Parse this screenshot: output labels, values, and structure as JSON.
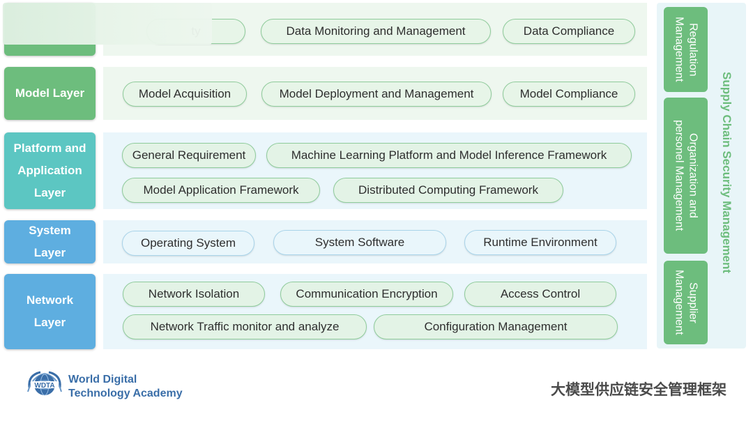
{
  "layers": [
    {
      "name": "",
      "pills": [
        {
          "label": "ty"
        },
        {
          "label": "Data Monitoring and Management"
        },
        {
          "label": "Data Compliance"
        }
      ]
    },
    {
      "name": "Model Layer",
      "pills": [
        {
          "label": "Model Acquisition"
        },
        {
          "label": "Model Deployment  and Management"
        },
        {
          "label": "Model Compliance"
        }
      ]
    },
    {
      "name": "Platform and\nApplication\nLayer",
      "pills": [
        {
          "label": "General Requirement"
        },
        {
          "label": "Machine Learning Platform and Model Inference Framework"
        },
        {
          "label": "Model Application Framework"
        },
        {
          "label": "Distributed Computing Framework"
        }
      ]
    },
    {
      "name": "System\nLayer",
      "pills": [
        {
          "label": "Operating System"
        },
        {
          "label": "System Software"
        },
        {
          "label": "Runtime Environment"
        }
      ]
    },
    {
      "name": "Network\nLayer",
      "pills": [
        {
          "label": "Network Isolation"
        },
        {
          "label": "Communication Encryption"
        },
        {
          "label": "Access Control"
        },
        {
          "label": "Network Traffic monitor and analyze"
        },
        {
          "label": "Configuration Management"
        }
      ]
    }
  ],
  "side_panel": {
    "title": "Supply Chain Security Management",
    "boxes": [
      {
        "label": "Regulation\nManagement"
      },
      {
        "label": "Organization and\npersonel Management"
      },
      {
        "label": "Supplier\nManagement"
      }
    ]
  },
  "footer": {
    "logo_text": "WDTA",
    "org_name": "World Digital\nTechnology Academy",
    "cn_title": "大模型供应链安全管理框架"
  },
  "colors": {
    "green_label": "#6dbd7d",
    "teal_label": "#5cc6c2",
    "blue_label": "#5eaee0",
    "green_band": "#eef7ef",
    "blue_band": "#eaf6fb"
  }
}
